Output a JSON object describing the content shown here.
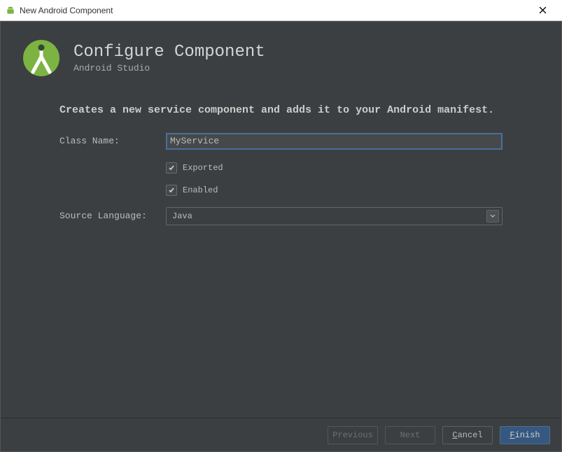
{
  "window": {
    "title": "New Android Component"
  },
  "header": {
    "title": "Configure Component",
    "subtitle": "Android Studio"
  },
  "description": "Creates a new service component and adds it to your Android manifest.",
  "form": {
    "className": {
      "label": "Class Name:",
      "value": "MyService"
    },
    "exported": {
      "label": "Exported",
      "checked": true
    },
    "enabled": {
      "label": "Enabled",
      "checked": true
    },
    "sourceLanguage": {
      "label": "Source Language:",
      "value": "Java"
    }
  },
  "buttons": {
    "previous": "Previous",
    "next": "Next",
    "cancel_pre": "",
    "cancel_ul": "C",
    "cancel_post": "ancel",
    "finish_pre": "",
    "finish_ul": "F",
    "finish_post": "inish"
  }
}
